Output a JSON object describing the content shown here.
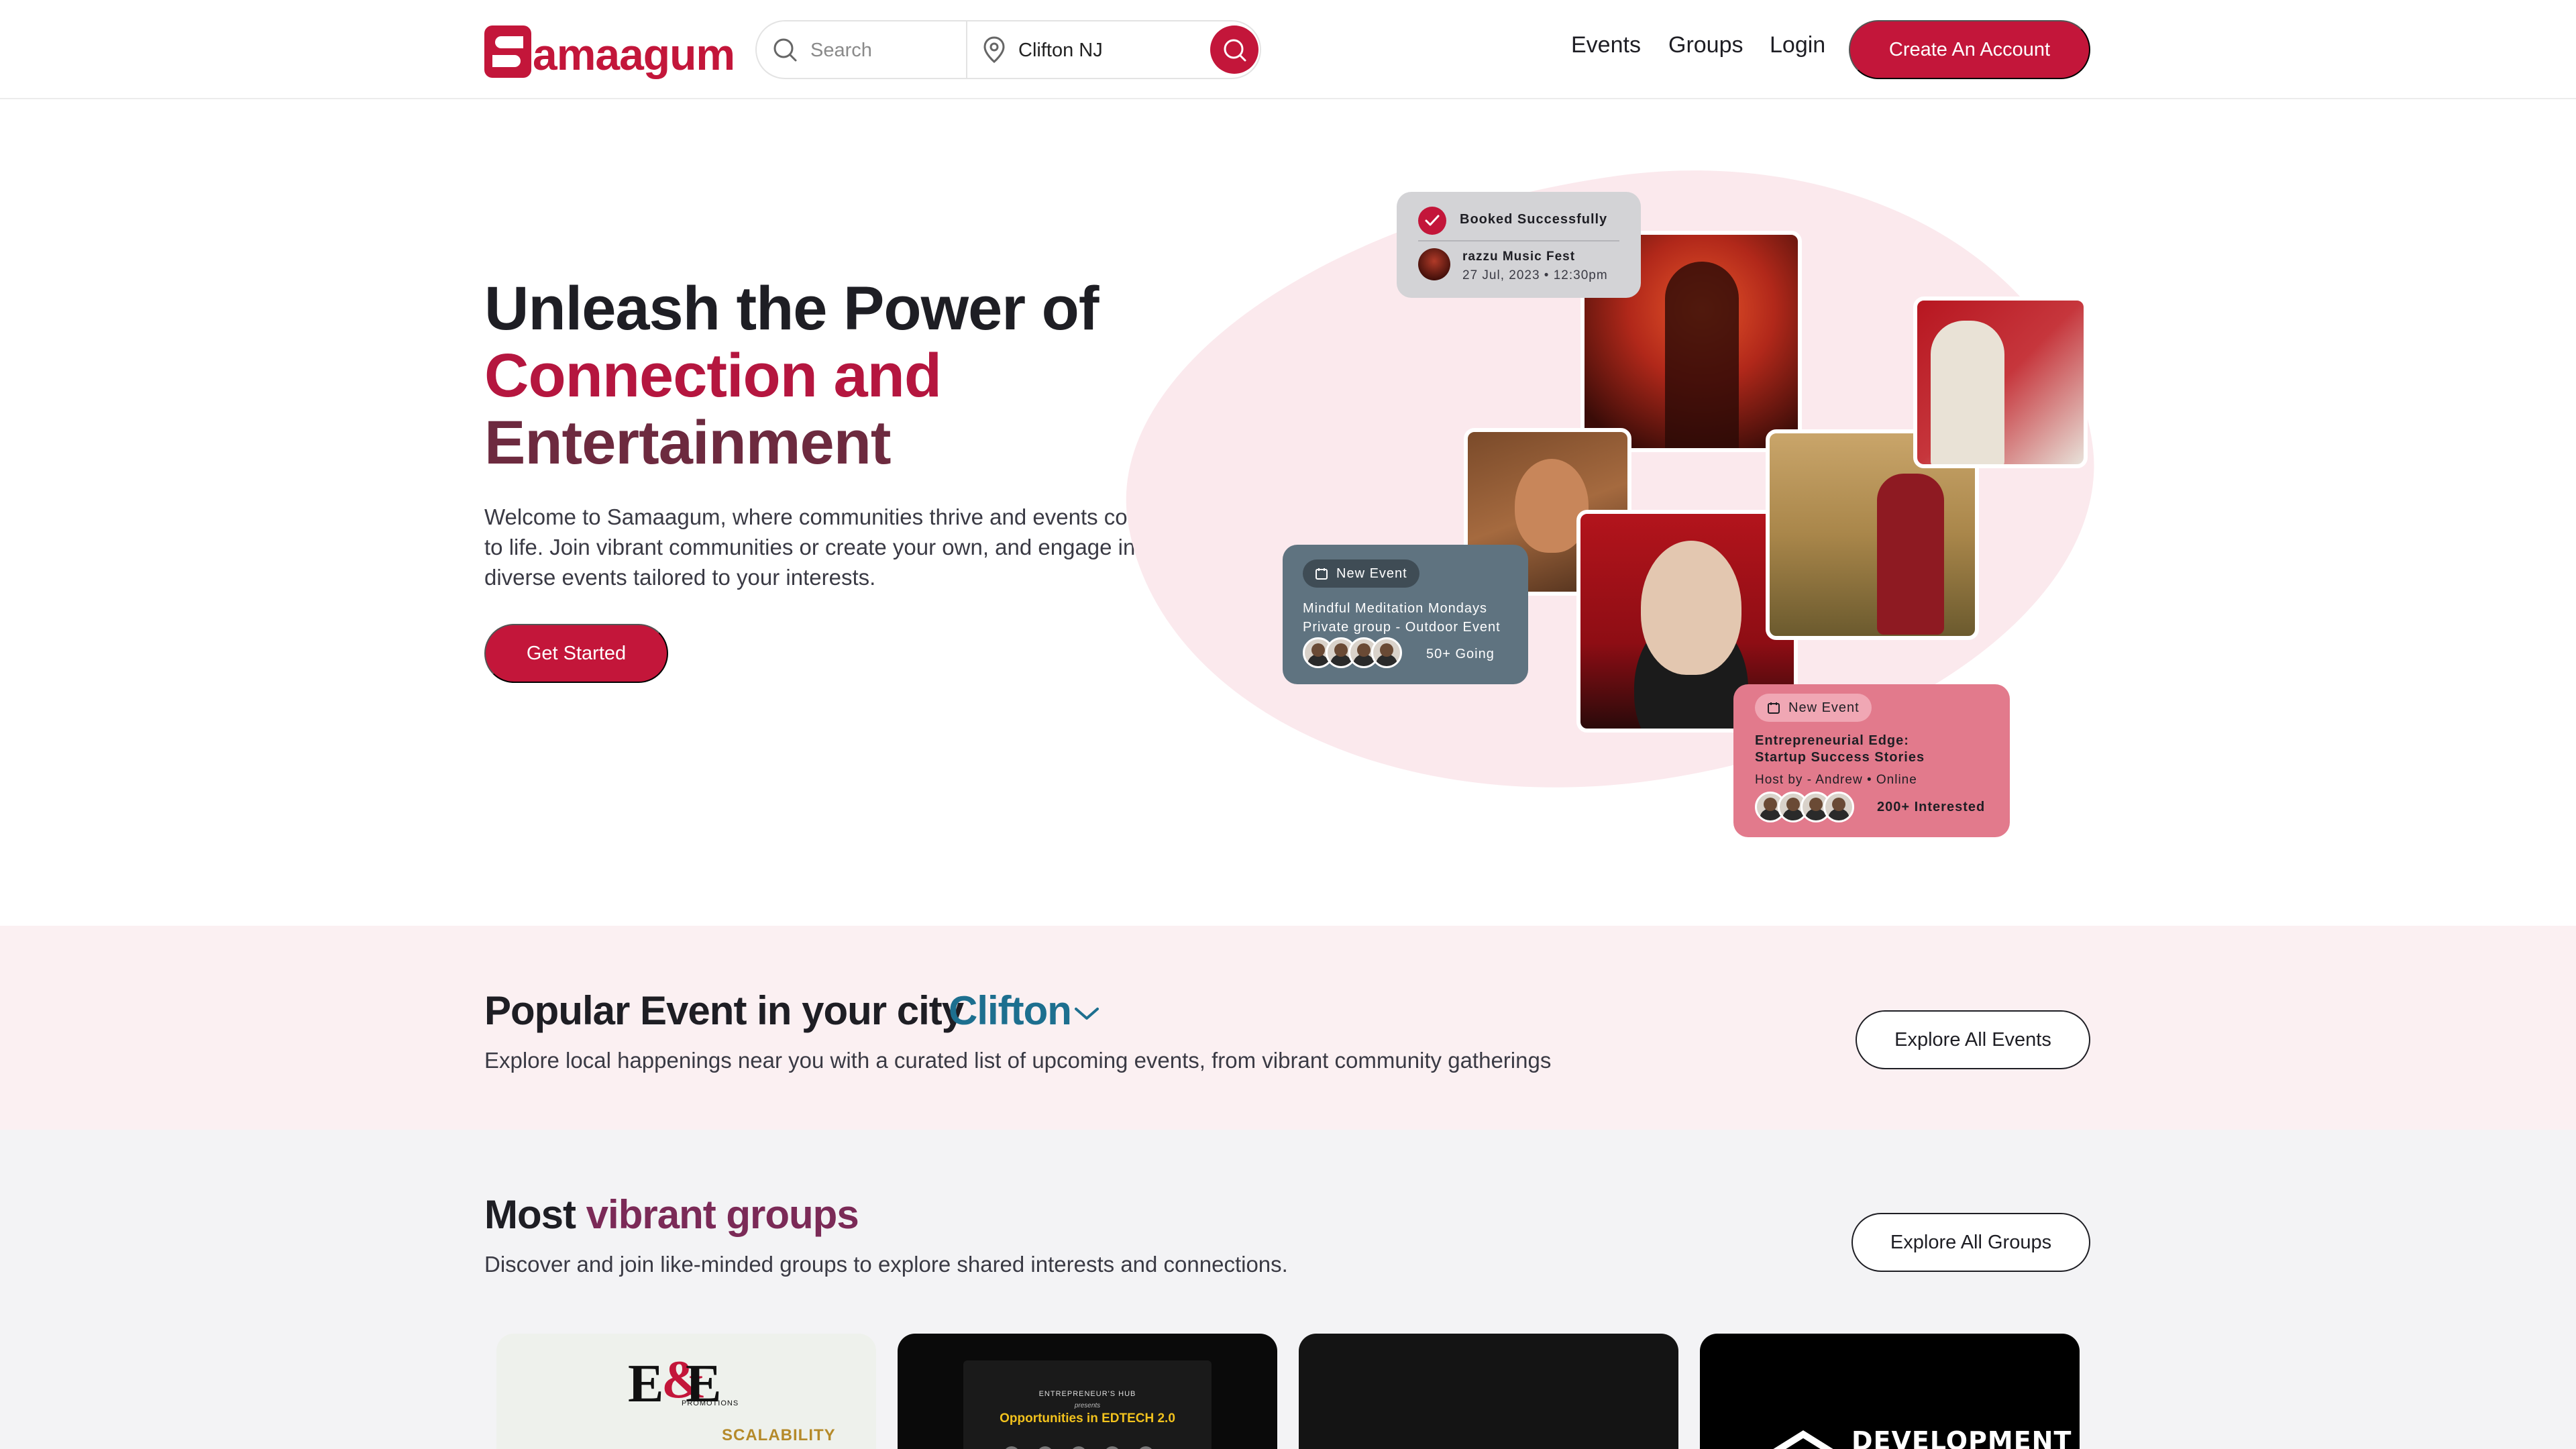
{
  "header": {
    "logo_text": "amaagum",
    "search": {
      "placeholder": "Search",
      "location_value": "Clifton NJ"
    },
    "nav": {
      "events": "Events",
      "groups": "Groups",
      "login": "Login"
    },
    "cta": "Create An Account"
  },
  "hero": {
    "title_line1": "Unleash the Power of",
    "title_line2": "Connection and",
    "title_line3": "Entertainment",
    "description": "Welcome to Samaagum, where communities thrive and events come to life. Join vibrant communities or create your own, and engage in diverse events tailored to your interests.",
    "button": "Get Started"
  },
  "cards": {
    "booked": {
      "title": "Booked Successfully",
      "event": "razzu Music Fest",
      "date": "27 Jul, 2023 • 12:30pm"
    },
    "meditation": {
      "badge": "New Event",
      "title": "Mindful Meditation Mondays",
      "subtitle": "Private group - Outdoor Event",
      "going": "50+ Going"
    },
    "entrepreneurial": {
      "badge": "New Event",
      "title_line1": "Entrepreneurial Edge:",
      "title_line2": "Startup Success Stories",
      "host": "Host by - Andrew • Online",
      "interested": "200+ Interested"
    }
  },
  "popular": {
    "title": "Popular Event in your city",
    "city": "Clifton",
    "description": "Explore local happenings near you with a curated list of upcoming events, from vibrant community gatherings",
    "button": "Explore All Events"
  },
  "groups": {
    "title_part1": "Most",
    "title_part2": "vibrant groups",
    "description": "Discover and join like-minded groups to explore shared interests and connections.",
    "button": "Explore All Groups",
    "card1": {
      "logo_part1": "E",
      "logo_part2": "&",
      "logo_part3": "E",
      "logo_sub": "PROMOTIONS",
      "tag": "SCALABILITY"
    },
    "card2": {
      "hub": "ENTREPRENEUR'S HUB",
      "presents": "presents",
      "title": "Opportunities in EDTECH 2.0"
    },
    "card4": {
      "text": "DEVELOPMENT"
    }
  },
  "colors": {
    "brand": "#c3163a",
    "city_accent": "#1d6f8f",
    "groups_accent": "#7b2a57",
    "popular_bg": "#fbf0f2",
    "groups_bg": "#f3f3f5"
  }
}
